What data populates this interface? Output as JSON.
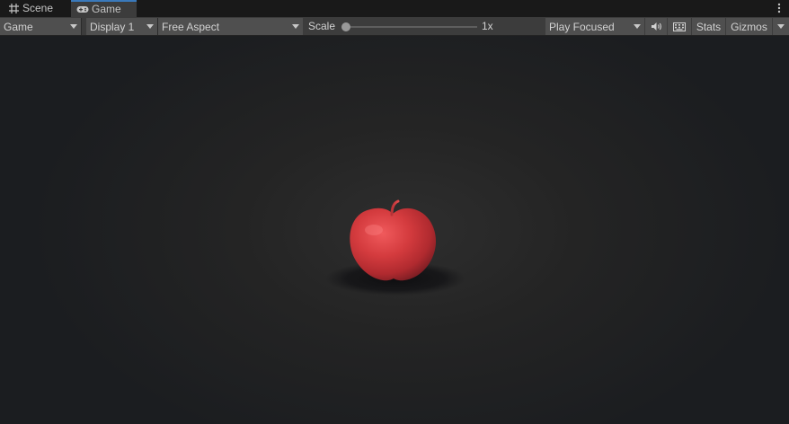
{
  "tabs": [
    {
      "label": "Scene",
      "icon": "grid-icon"
    },
    {
      "label": "Game",
      "icon": "gamepad-icon"
    }
  ],
  "toolbar": {
    "view_mode": "Game",
    "display": "Display 1",
    "aspect": "Free Aspect",
    "scale_label": "Scale",
    "scale_value": "1x",
    "play_mode": "Play Focused",
    "stats": "Stats",
    "gizmos": "Gizmos"
  },
  "scene": {
    "object_icon": "apple"
  },
  "colors": {
    "accent_tab": "#3a79bb",
    "apple_red": "#d43b3e"
  }
}
